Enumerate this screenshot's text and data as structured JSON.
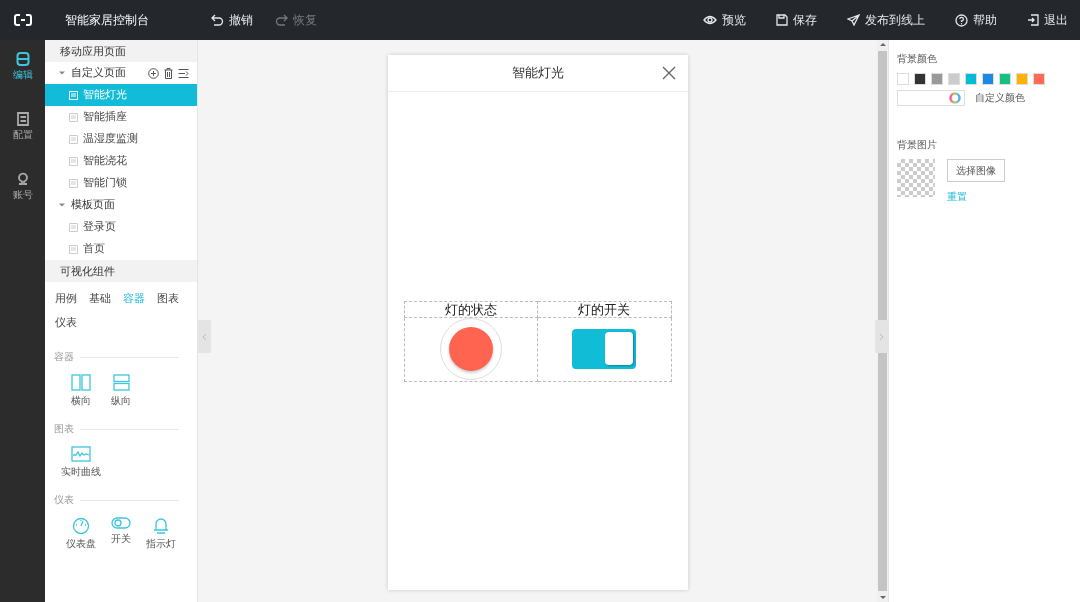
{
  "topbar": {
    "title": "智能家居控制台",
    "history": [
      {
        "label": "撤销",
        "kind": "undo",
        "disabled": false
      },
      {
        "label": "恢复",
        "kind": "redo",
        "disabled": true
      }
    ],
    "actions": [
      {
        "label": "预览",
        "kind": "eye"
      },
      {
        "label": "保存",
        "kind": "save"
      },
      {
        "label": "发布到线上",
        "kind": "send"
      },
      {
        "label": "帮助",
        "kind": "help"
      },
      {
        "label": "退出",
        "kind": "exit"
      }
    ]
  },
  "rail": [
    {
      "label": "编辑",
      "kind": "database",
      "selected": true
    },
    {
      "label": "配置",
      "kind": "document",
      "selected": false
    },
    {
      "label": "账号",
      "kind": "user",
      "selected": false
    }
  ],
  "pages": {
    "header": "移动应用页面",
    "groups": [
      {
        "label": "自定义页面",
        "expanded": true,
        "tools": true,
        "children": [
          {
            "label": "智能灯光",
            "selected": true
          },
          {
            "label": "智能插座",
            "selected": false
          },
          {
            "label": "温湿度监测",
            "selected": false
          },
          {
            "label": "智能浇花",
            "selected": false
          },
          {
            "label": "智能门锁",
            "selected": false
          }
        ]
      },
      {
        "label": "模板页面",
        "expanded": true,
        "tools": false,
        "children": [
          {
            "label": "登录页",
            "selected": false
          },
          {
            "label": "首页",
            "selected": false
          }
        ]
      }
    ]
  },
  "components": {
    "header": "可视化组件",
    "tabs": [
      {
        "label": "用例",
        "selected": false
      },
      {
        "label": "基础",
        "selected": false
      },
      {
        "label": "容器",
        "selected": true
      },
      {
        "label": "图表",
        "selected": false
      },
      {
        "label": "仪表",
        "selected": false
      }
    ],
    "sections": [
      {
        "title": "容器",
        "items": [
          {
            "label": "横向",
            "kind": "columns"
          },
          {
            "label": "纵向",
            "kind": "rows"
          }
        ]
      },
      {
        "title": "图表",
        "items": [
          {
            "label": "实时曲线",
            "kind": "chart"
          }
        ]
      },
      {
        "title": "仪表",
        "items": [
          {
            "label": "仪表盘",
            "kind": "gauge"
          },
          {
            "label": "开关",
            "kind": "toggle"
          },
          {
            "label": "指示灯",
            "kind": "lamp"
          }
        ]
      }
    ]
  },
  "phone": {
    "title": "智能灯光",
    "table": {
      "columns": [
        "灯的状态",
        "灯的开关"
      ],
      "cells": [
        {
          "kind": "indicator",
          "on": true
        },
        {
          "kind": "switch",
          "on": true
        }
      ]
    }
  },
  "properties": {
    "background_color": {
      "label": "背景颜色",
      "swatches": [
        {
          "color": "#ffffff"
        },
        {
          "color": "#333333"
        },
        {
          "color": "#999999"
        },
        {
          "color": "#cccccc"
        },
        {
          "color": "#00bcd4"
        },
        {
          "color": "#1e88e5"
        },
        {
          "color": "#17c080"
        },
        {
          "color": "#ffb300"
        },
        {
          "color": "#ff6a55"
        }
      ],
      "custom_label": "自定义颜色"
    },
    "background_image": {
      "label": "背景图片",
      "choose_button": "选择图像",
      "reset_link": "重置"
    }
  }
}
